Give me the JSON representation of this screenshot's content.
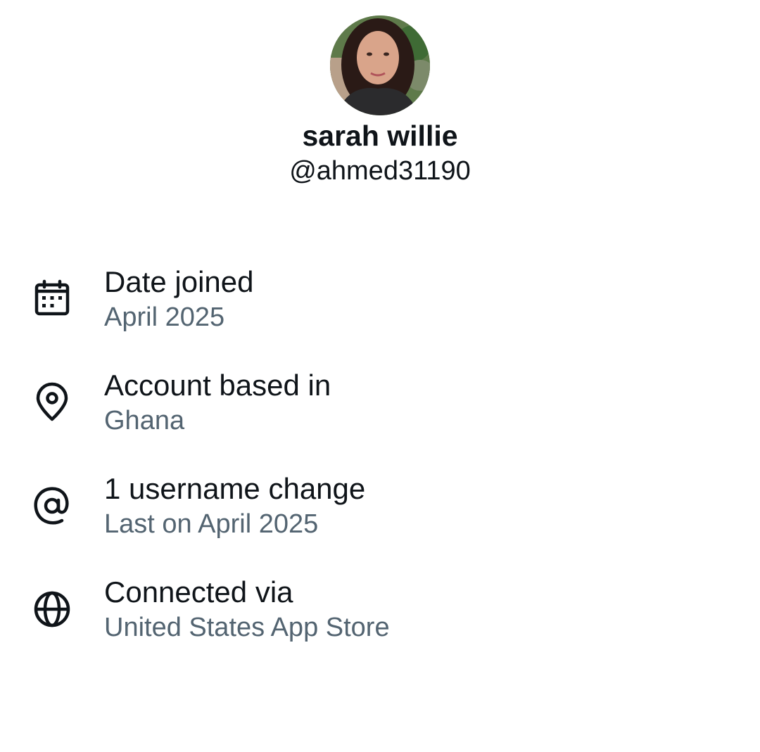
{
  "profile": {
    "display_name": "sarah willie",
    "handle": "@ahmed31190",
    "avatar_icon": "profile-photo"
  },
  "colors": {
    "primary_text": "#0f1419",
    "secondary_text": "#536471",
    "icon": "#0f1419",
    "background": "#ffffff"
  },
  "info": [
    {
      "icon": "calendar-icon",
      "title": "Date joined",
      "subtitle": "April 2025"
    },
    {
      "icon": "location-pin-icon",
      "title": "Account based in",
      "subtitle": "Ghana"
    },
    {
      "icon": "at-sign-icon",
      "title": "1 username change",
      "subtitle": "Last on April 2025"
    },
    {
      "icon": "globe-icon",
      "title": "Connected via",
      "subtitle": "United States App Store"
    }
  ]
}
